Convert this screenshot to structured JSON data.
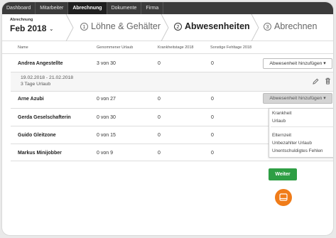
{
  "nav": {
    "tabs": [
      {
        "label": "Dashboard",
        "active": false
      },
      {
        "label": "Mitarbeiter",
        "active": false
      },
      {
        "label": "Abrechnung",
        "active": true
      },
      {
        "label": "Dokumente",
        "active": false
      },
      {
        "label": "Firma",
        "active": false
      }
    ]
  },
  "wizard": {
    "period_label": "Abrechnung",
    "period_value": "Feb 2018",
    "steps": [
      {
        "num": "1",
        "label": "Löhne & Gehälter",
        "active": false
      },
      {
        "num": "2",
        "label": "Abwesenheiten",
        "active": true
      },
      {
        "num": "3",
        "label": "Abrechnen",
        "active": false
      }
    ]
  },
  "table": {
    "headers": [
      "Name",
      "Genommener Urlaub",
      "Krankheitstage 2018",
      "Sonstige Fehltage 2018"
    ],
    "rows": [
      {
        "name": "Andrea Angestellte",
        "vacation": "3 von 30",
        "sick": "0",
        "other": "0",
        "button": "Abwesenheit hinzufügen ▾"
      },
      {
        "name": "Arne Azubi",
        "vacation": "0 von 27",
        "sick": "0",
        "other": "0",
        "button": "Abwesenheit hinzufügen ▾"
      },
      {
        "name": "Gerda Geselschafterin",
        "vacation": "0 von 30",
        "sick": "0",
        "other": "0",
        "button": ""
      },
      {
        "name": "Guido Gleitzone",
        "vacation": "0 von 15",
        "sick": "0",
        "other": "0",
        "button": ""
      },
      {
        "name": "Markus Minijobber",
        "vacation": "0 von 9",
        "sick": "0",
        "other": "0",
        "button": ""
      }
    ],
    "absence": {
      "dates": "19.02.2018 - 21.02.2018",
      "days": "3 Tage Urlaub"
    }
  },
  "dropdown": {
    "items": [
      "Krankheit",
      "Urlaub",
      "Elternzeit",
      "Unbezahlter Urlaub",
      "Unentschuldigtes Fehlen"
    ]
  },
  "actions": {
    "next": "Weiter"
  },
  "colors": {
    "accent_green": "#2e9e44",
    "chat_orange": "#f07c19",
    "nav_dark": "#3b3b3b"
  },
  "icons": {
    "edit": "pencil-icon",
    "delete": "trash-icon",
    "chat": "chat-icon"
  }
}
